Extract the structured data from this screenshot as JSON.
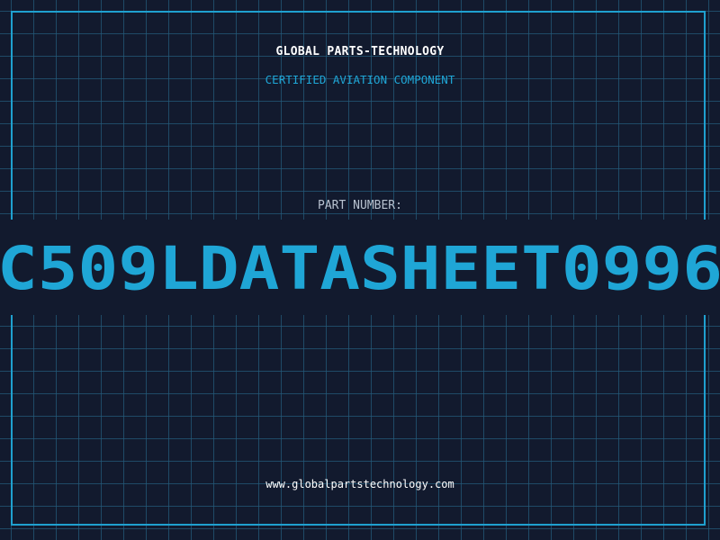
{
  "header": {
    "company": "GLOBAL PARTS-TECHNOLOGY",
    "subtitle": "CERTIFIED AVIATION COMPONENT"
  },
  "part": {
    "label": "PART NUMBER:",
    "number": "C509LDATASHEET0996"
  },
  "footer": {
    "url": "www.globalpartstechnology.com"
  },
  "colors": {
    "background": "#121a2e",
    "grid": "#235a78",
    "accent": "#1fa6d6",
    "frame": "#1fa0cf",
    "text": "#ffffff",
    "label": "#b8c2d0"
  }
}
